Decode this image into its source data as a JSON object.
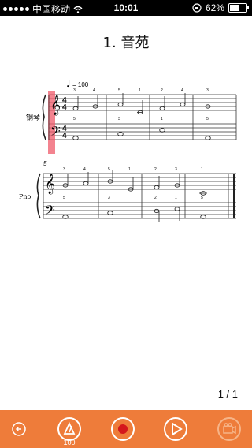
{
  "status_bar": {
    "carrier": "中国移动",
    "time": "10:01",
    "battery": "62%",
    "battery_level": 0.62
  },
  "score": {
    "title": "1. 音苑",
    "tempo_label": "= 100",
    "system1_instrument": "钢琴",
    "system2_instrument": "Pno.",
    "measure_number": "5",
    "fingerings": {
      "s1_treble": [
        "3",
        "4",
        "5",
        "1",
        "2",
        "4",
        "3"
      ],
      "s1_bass": [
        "5",
        "3",
        "1",
        "5"
      ],
      "s2_treble": [
        "3",
        "4",
        "5",
        "1",
        "2",
        "3",
        "1"
      ],
      "s2_bass": [
        "5",
        "3",
        "2",
        "1",
        "5"
      ]
    },
    "time_signature": [
      "4",
      "4"
    ],
    "page": "1 / 1"
  },
  "toolbar": {
    "tempo_value": "100",
    "accent_color": "#ee7c3a",
    "buttons": [
      "back-icon",
      "metronome-icon",
      "record-icon",
      "play-icon",
      "video-icon"
    ]
  }
}
